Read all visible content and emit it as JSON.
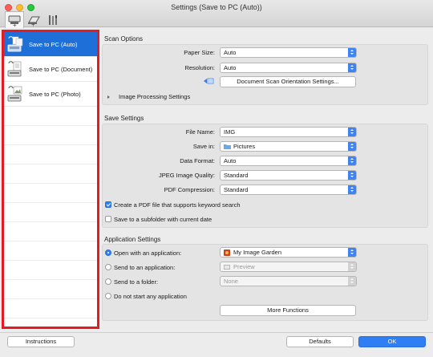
{
  "window": {
    "title": "Settings (Save to PC (Auto))"
  },
  "tabs": [
    {
      "name": "scan-from-computer-tab",
      "icon": "scanner-icon",
      "plus": "+"
    },
    {
      "name": "scan-from-panel-tab",
      "icon": "scanner-panel-icon",
      "plus": "+"
    },
    {
      "name": "general-settings-tab",
      "icon": "tools-icon"
    }
  ],
  "sidebar": {
    "items": [
      {
        "label": "Save to PC (Auto)",
        "selected": true
      },
      {
        "label": "Save to PC (Document)"
      },
      {
        "label": "Save to PC (Photo)"
      }
    ]
  },
  "scan_options": {
    "title": "Scan Options",
    "paper_size_label": "Paper Size:",
    "paper_size_value": "Auto",
    "resolution_label": "Resolution:",
    "resolution_value": "Auto",
    "orientation_button": "Document Scan Orientation Settings...",
    "image_processing_label": "Image Processing Settings"
  },
  "save_settings": {
    "title": "Save Settings",
    "file_name_label": "File Name:",
    "file_name_value": "IMG",
    "save_in_label": "Save in:",
    "save_in_value": "Pictures",
    "data_format_label": "Data Format:",
    "data_format_value": "Auto",
    "jpeg_quality_label": "JPEG Image Quality:",
    "jpeg_quality_value": "Standard",
    "pdf_compression_label": "PDF Compression:",
    "pdf_compression_value": "Standard",
    "keyword_search_label": "Create a PDF file that supports keyword search",
    "keyword_search_checked": true,
    "subfolder_label": "Save to a subfolder with current date",
    "subfolder_checked": false
  },
  "application_settings": {
    "title": "Application Settings",
    "open_with_label": "Open with an application:",
    "open_with_value": "My Image Garden",
    "send_to_app_label": "Send to an application:",
    "send_to_app_value": "Preview",
    "send_to_folder_label": "Send to a folder:",
    "send_to_folder_value": "None",
    "do_not_start_label": "Do not start any application",
    "selected_option": "open_with",
    "more_functions_button": "More Functions"
  },
  "footer": {
    "instructions_button": "Instructions",
    "defaults_button": "Defaults",
    "ok_button": "OK"
  },
  "colors": {
    "accent": "#2f7ef4",
    "selection": "#1f6fd8",
    "highlight_border": "#e61a22"
  }
}
